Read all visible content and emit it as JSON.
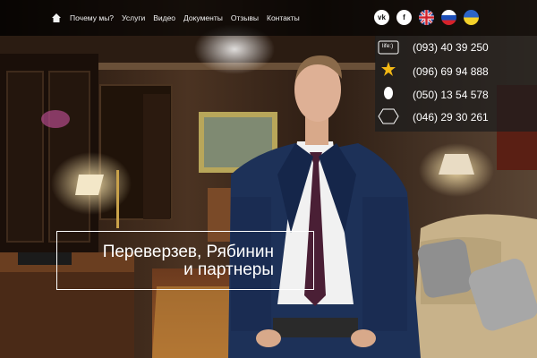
{
  "nav": {
    "items": [
      "Почему мы?",
      "Услуги",
      "Видео",
      "Документы",
      "Отзывы",
      "Контакты"
    ],
    "home_icon": "home-icon"
  },
  "social": {
    "vk_text": "vk",
    "fb_text": "f",
    "flags": [
      "flag-uk-icon",
      "flag-ru-icon",
      "flag-ua-icon"
    ]
  },
  "contacts": {
    "phones": [
      "(093) 40 39 250",
      "(096) 69 94 888",
      "(050) 13 54 578",
      "(046) 29 30 261"
    ],
    "operators": [
      "life:)",
      "КИЇВСТАР",
      "МТС",
      "CDMA"
    ]
  },
  "hero": {
    "line1": "Переверзев, Рябинин",
    "line2": "и партнеры"
  },
  "colors": {
    "nav_bg": "#000000",
    "wood": "#3a2417",
    "suit": "#1d3158",
    "tie": "#4a1f35"
  }
}
